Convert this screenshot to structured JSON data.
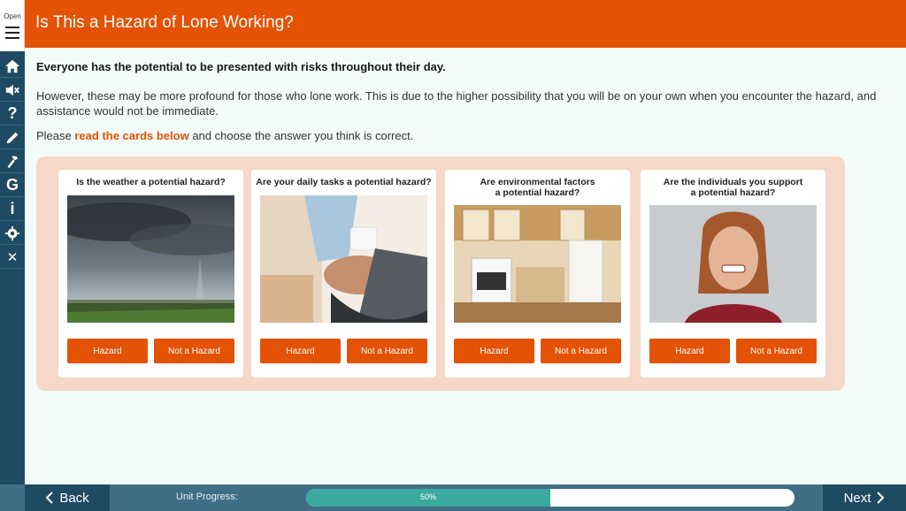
{
  "rail": {
    "open_label": "Open",
    "items": [
      {
        "icon": "home-icon"
      },
      {
        "icon": "mute-icon"
      },
      {
        "icon": "help-icon",
        "glyph": "?"
      },
      {
        "icon": "pencil-icon"
      },
      {
        "icon": "hammer-icon"
      },
      {
        "icon": "glossary-icon",
        "glyph": "G"
      },
      {
        "icon": "info-icon",
        "glyph": "i"
      },
      {
        "icon": "gear-icon"
      },
      {
        "icon": "close-icon",
        "glyph": "✕"
      }
    ]
  },
  "header": {
    "title": "Is This a Hazard of Lone Working?"
  },
  "content": {
    "intro_bold": "Everyone has the potential to be presented with risks throughout their day.",
    "intro_body": "However, these may be more profound for those who lone work. This is due to the higher possibility that you will be on your own when you encounter the hazard, and assistance would not be immediate.",
    "instruction_pre": "Please ",
    "instruction_highlight": "read the cards below",
    "instruction_post": " and choose the answer you think is correct."
  },
  "cards": [
    {
      "question": "Is the weather a potential hazard?",
      "hazard_label": "Hazard",
      "not_hazard_label": "Not a Hazard"
    },
    {
      "question": "Are your daily tasks a potential hazard?",
      "hazard_label": "Hazard",
      "not_hazard_label": "Not a Hazard"
    },
    {
      "question": "Are environmental factors\na potential hazard?",
      "hazard_label": "Hazard",
      "not_hazard_label": "Not a Hazard"
    },
    {
      "question": "Are the individuals you support\na potential hazard?",
      "hazard_label": "Hazard",
      "not_hazard_label": "Not a Hazard"
    }
  ],
  "footer": {
    "back_label": "Back",
    "next_label": "Next",
    "unit_progress_label": "Unit Progress:",
    "progress_value": 50,
    "progress_text": "50%"
  },
  "colors": {
    "accent": "#e35205",
    "rail": "#1e4a63",
    "footer": "#3f6f87",
    "progress": "#3aaa9e",
    "panel": "#f5d8c7"
  }
}
